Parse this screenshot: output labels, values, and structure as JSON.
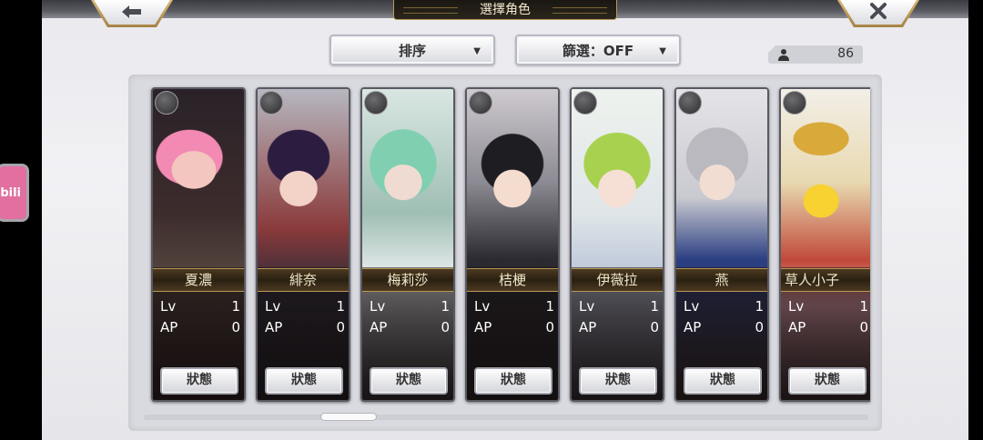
{
  "header": {
    "title": "選擇角色"
  },
  "controls": {
    "sort_label": "排序",
    "filter_label": "篩選：OFF",
    "caret": "▼"
  },
  "roster": {
    "count": "86"
  },
  "side_tab": {
    "label": "bili"
  },
  "stat_labels": {
    "lv": "Lv",
    "ap": "AP"
  },
  "status_button_label": "狀態",
  "characters": [
    {
      "name": "夏濃",
      "lv": "1",
      "ap": "0",
      "type_icon": "sword-icon"
    },
    {
      "name": "緋奈",
      "lv": "1",
      "ap": "0",
      "type_icon": "sword-icon"
    },
    {
      "name": "梅莉莎",
      "lv": "1",
      "ap": "0",
      "type_icon": "sword-icon"
    },
    {
      "name": "桔梗",
      "lv": "1",
      "ap": "0",
      "type_icon": "sword-icon"
    },
    {
      "name": "伊薇拉",
      "lv": "1",
      "ap": "0",
      "type_icon": "spear-icon"
    },
    {
      "name": "燕",
      "lv": "1",
      "ap": "0",
      "type_icon": "fist-icon"
    },
    {
      "name": "草人小子",
      "lv": "1",
      "ap": "0",
      "type_icon": "fist-icon"
    }
  ],
  "colors": {
    "accent_gold": "#b9975a",
    "panel": "#d9dadf",
    "bilibili_pink": "#e26fa0"
  }
}
